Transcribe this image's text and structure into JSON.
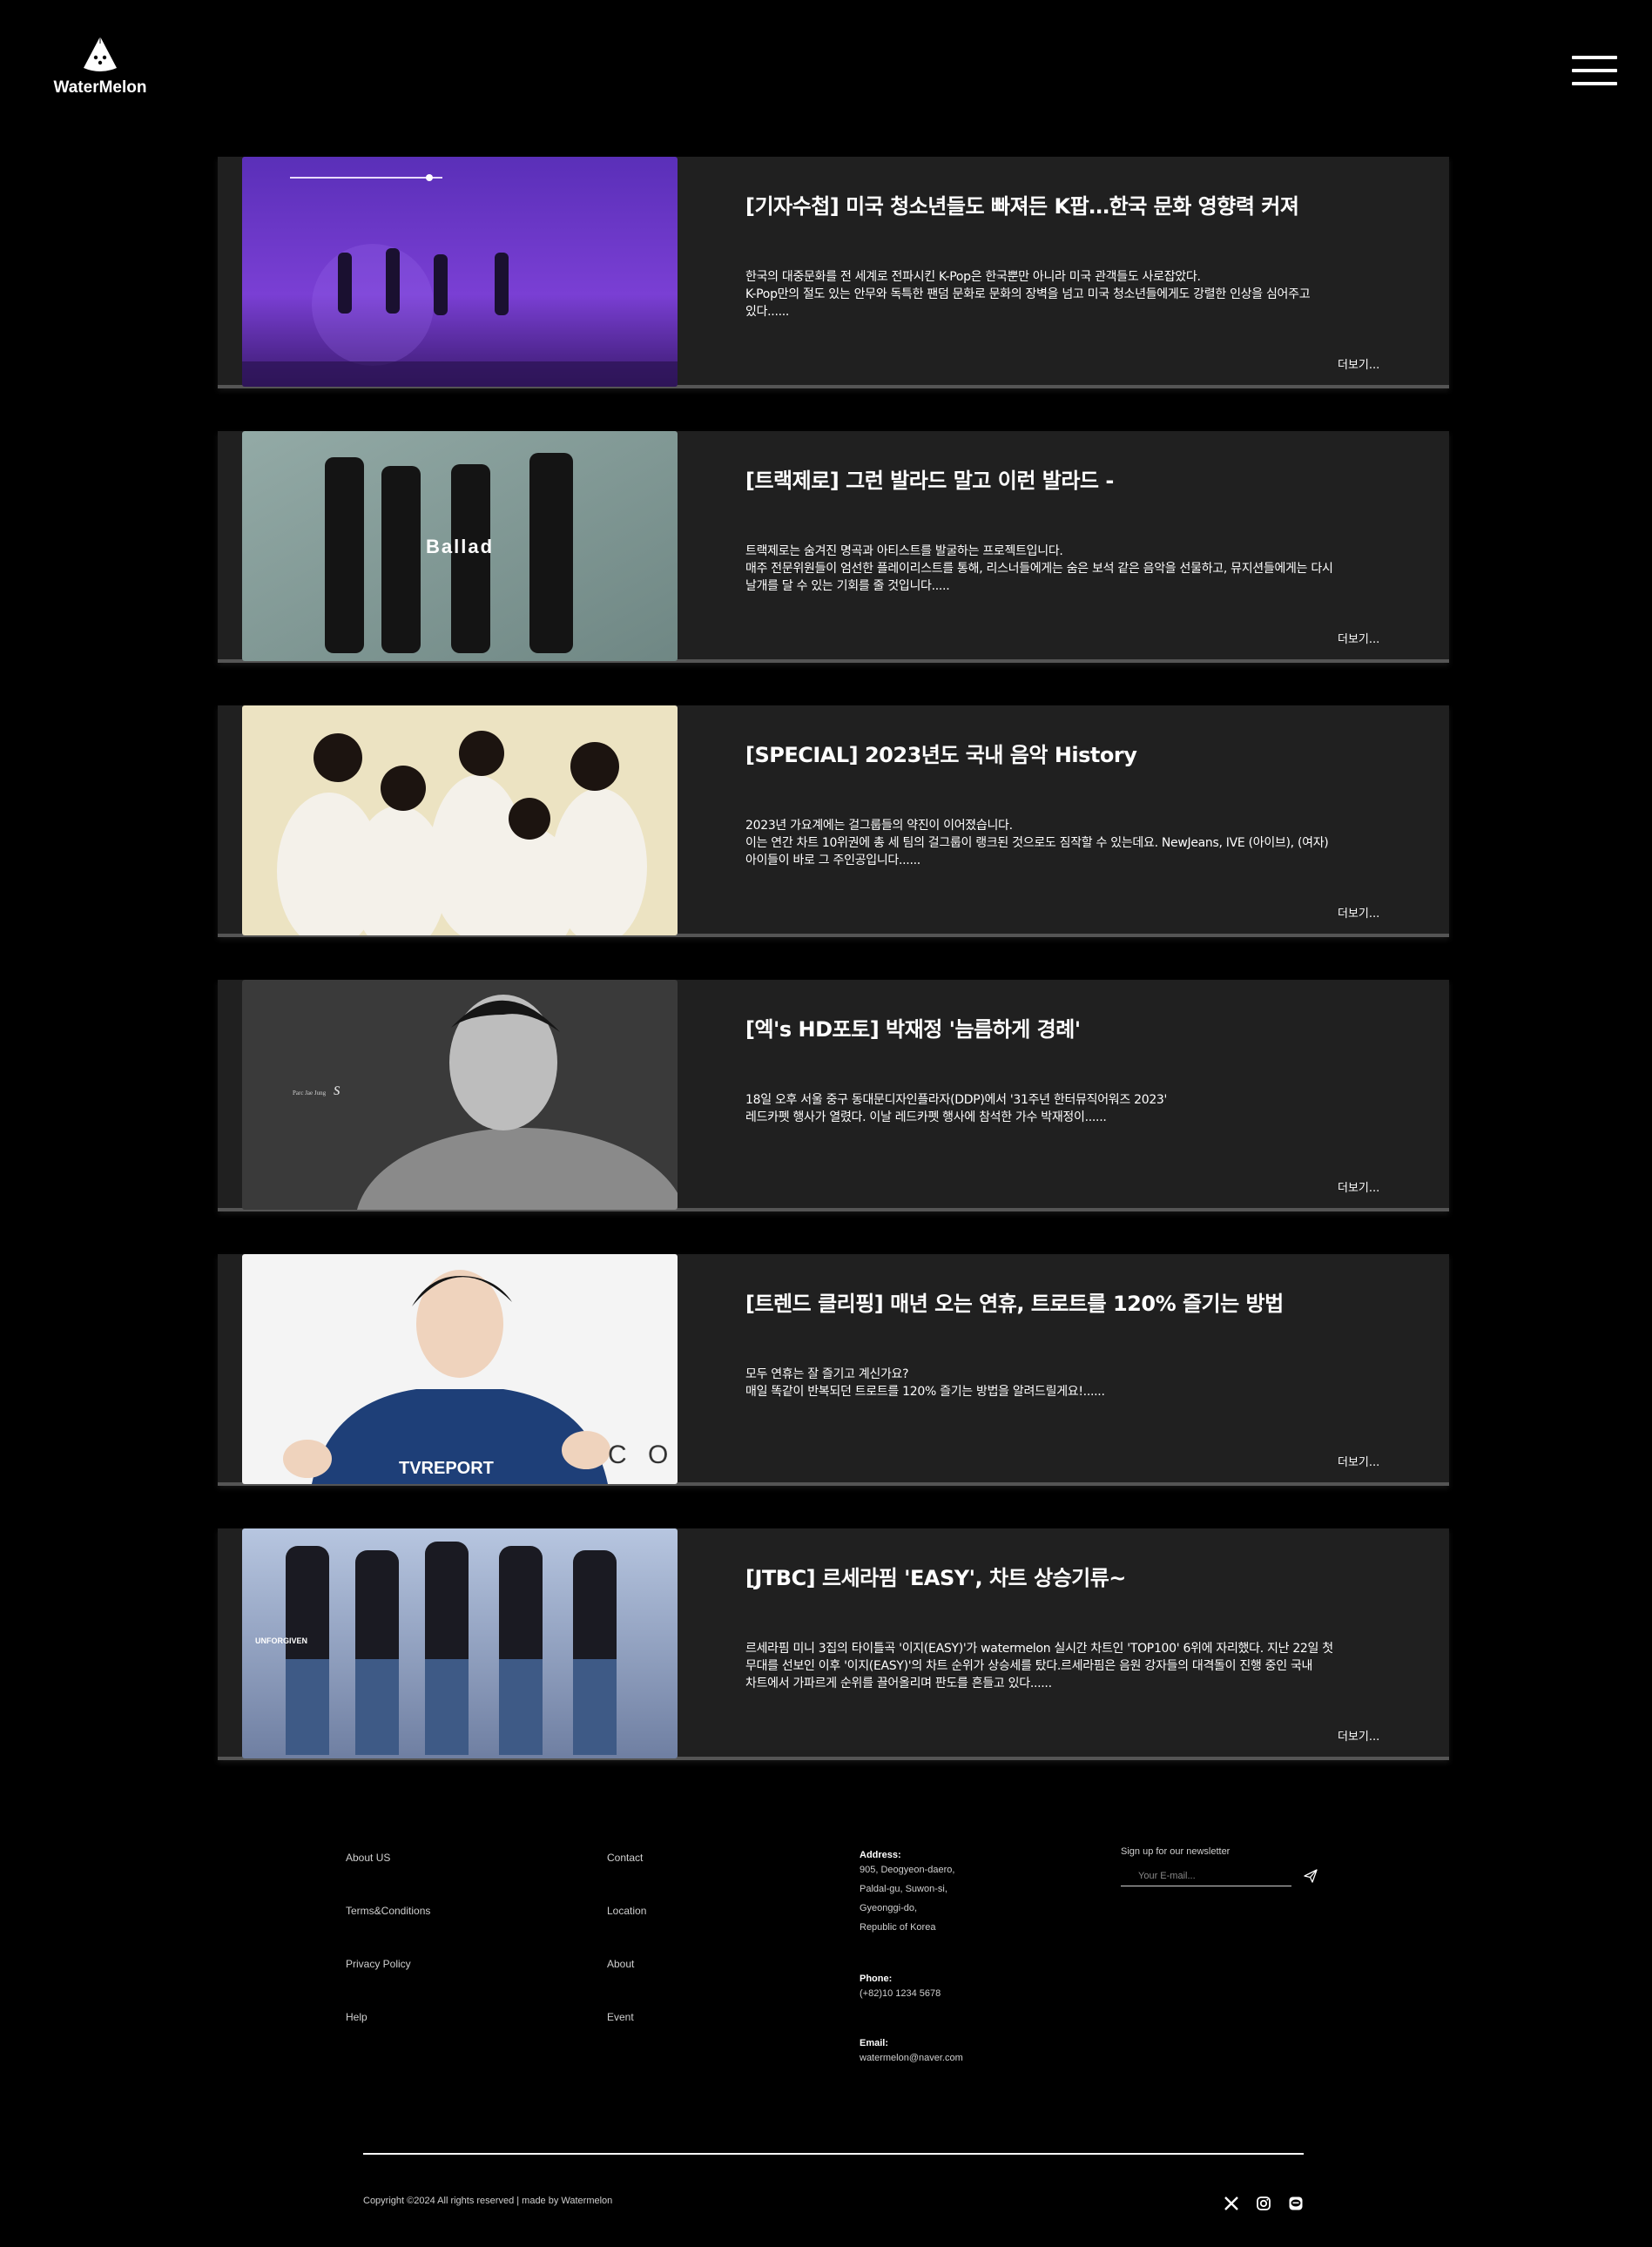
{
  "header": {
    "logo_text": "WaterMelon"
  },
  "articles": [
    {
      "title": "[기자수첩] 미국 청소년들도 빠져든 K팝…한국 문화 영향력 커져",
      "desc": "한국의 대중문화를 전 세계로 전파시킨 K-Pop은 한국뿐만 아니라 미국 관객들도 사로잡았다.\nK-Pop만의 절도 있는 안무와 독특한 팬덤 문화로 문화의 장벽을 넘고 미국 청소년들에게도 강렬한 인상을 심어주고\n있다......",
      "more": "더보기..."
    },
    {
      "title": "[트랙제로] 그런 발라드 말고 이런 발라드 -",
      "desc": "트랙제로는 숨겨진 명곡과 아티스트를 발굴하는 프로젝트입니다.\n매주 전문위원들이 엄선한 플레이리스트를 통해, 리스너들에게는 숨은 보석 같은 음악을 선물하고, 뮤지션들에게는 다시\n날개를 달 수 있는 기회를 줄 것입니다.....",
      "more": "더보기...",
      "image_caption": "Ballad"
    },
    {
      "title": "[SPECIAL] 2023년도 국내 음악 History",
      "desc": "2023년 가요계에는 걸그룹들의 약진이 이어졌습니다.\n이는 연간 차트 10위권에 총 세 팀의 걸그룹이 랭크된 것으로도 짐작할 수 있는데요. NewJeans, IVE (아이브), (여자)\n아이들이 바로 그 주인공입니다......",
      "more": "더보기..."
    },
    {
      "title": "[엑's HD포토] 박재정 '늠름하게 경례'",
      "desc": "18일 오후 서울 중구 동대문디자인플라자(DDP)에서 '31주년 한터뮤직어워즈 2023'\n레드카펫 행사가 열렸다. 이날 레드카펫 행사에 참석한 가수 박재정이......",
      "more": "더보기...",
      "image_caption": "Parc Jae Jung"
    },
    {
      "title": "[트렌드 클리핑] 매년 오는 연휴, 트로트를 120% 즐기는 방법",
      "desc": "모두 연휴는 잘 즐기고 계신가요?\n매일 똑같이 반복되던 트로트를 120% 즐기는 방법을 알려드릴게요!......",
      "more": "더보기...",
      "image_caption": "TVREPORT"
    },
    {
      "title": "[JTBC] 르세라핌 'EASY', 차트 상승기류~",
      "desc": "르세라핌 미니 3집의 타이틀곡 '이지(EASY)'가 watermelon 실시간 차트인 'TOP100' 6위에 자리했다. 지난 22일 첫\n무대를 선보인 이후 '이지(EASY)'의 차트 순위가 상승세를 탔다.르세라핌은 음원 강자들의 대격돌이 진행 중인 국내\n차트에서 가파르게 순위를 끌어올리며 판도를 흔들고 있다......",
      "more": "더보기...",
      "image_caption": "UNFORGIVEN"
    }
  ],
  "footer": {
    "links_col1": [
      "About US",
      "Terms&Conditions",
      "Privacy Policy",
      "Help"
    ],
    "links_col2": [
      "Contact",
      "Location",
      "About",
      "Event"
    ],
    "address_label": "Address:",
    "address_value": "905, Deogyeon-daero,\nPaldal-gu, Suwon-si,\nGyeonggi-do,\nRepublic of Korea",
    "phone_label": "Phone:",
    "phone_value": "(+82)10 1234 5678",
    "email_label": "Email:",
    "email_value": "watermelon@naver.com",
    "newsletter_title": "Sign up for our newsletter",
    "newsletter_placeholder": "Your E-mail...",
    "copyright": "Copyright ©2024 All rights reserved | made by Watermelon",
    "socials": [
      "x-icon",
      "instagram-icon",
      "line-icon"
    ]
  },
  "colors": {
    "background": "#000000",
    "card": "#202020",
    "text": "#ffffff"
  }
}
